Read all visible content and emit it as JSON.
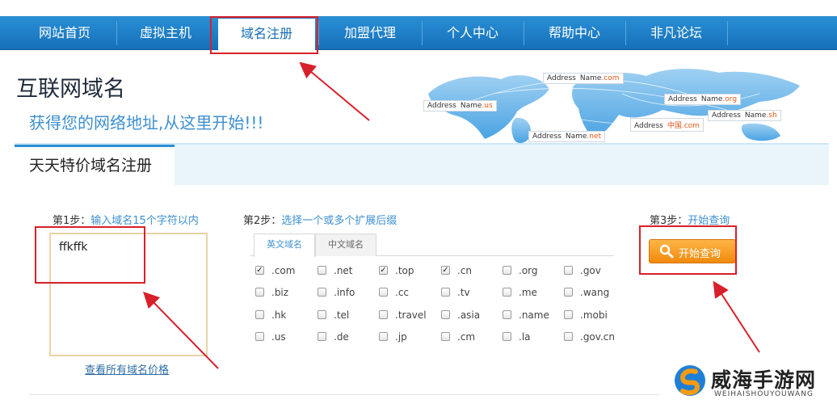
{
  "nav": {
    "items": [
      "网站首页",
      "虚拟主机",
      "域名注册",
      "加盟代理",
      "个人中心",
      "帮助中心",
      "非凡论坛"
    ],
    "active_index": 2
  },
  "header": {
    "title": "互联网域名",
    "subtitle": "获得您的网络地址,从这里开始!!!"
  },
  "map": {
    "tags": [
      {
        "addr": "Address",
        "name": "Name",
        "tld": ".com"
      },
      {
        "addr": "Address",
        "name": "Name",
        "tld": ".us"
      },
      {
        "addr": "Address",
        "name": "Name",
        "tld": ".org"
      },
      {
        "addr": "Address",
        "name": "Name",
        "tld": ".sh"
      },
      {
        "addr": "Address",
        "name": "中国",
        "tld": ".com"
      },
      {
        "addr": "Address",
        "name": "Name",
        "tld": ".net"
      }
    ]
  },
  "panel": {
    "tab_label": "天天特价域名注册"
  },
  "step1": {
    "prefix": "第1步：",
    "text": "输入域名15个字符以内",
    "input_value": "ffkffk",
    "price_link": "查看所有域名价格"
  },
  "step2": {
    "prefix": "第2步：",
    "text": "选择一个或多个扩展后缀",
    "tabs": [
      "英文域名",
      "中文域名"
    ],
    "active_tab": 0,
    "extensions": [
      [
        {
          "ext": ".com",
          "checked": true
        },
        {
          "ext": ".net",
          "checked": false
        },
        {
          "ext": ".top",
          "checked": true
        },
        {
          "ext": ".cn",
          "checked": true
        },
        {
          "ext": ".org",
          "checked": false
        },
        {
          "ext": ".gov",
          "checked": false
        }
      ],
      [
        {
          "ext": ".biz",
          "checked": false
        },
        {
          "ext": ".info",
          "checked": false
        },
        {
          "ext": ".cc",
          "checked": false
        },
        {
          "ext": ".tv",
          "checked": false
        },
        {
          "ext": ".me",
          "checked": false
        },
        {
          "ext": ".wang",
          "checked": false
        }
      ],
      [
        {
          "ext": ".hk",
          "checked": false
        },
        {
          "ext": ".tel",
          "checked": false
        },
        {
          "ext": ".travel",
          "checked": false
        },
        {
          "ext": ".asia",
          "checked": false
        },
        {
          "ext": ".name",
          "checked": false
        },
        {
          "ext": ".mobi",
          "checked": false
        }
      ],
      [
        {
          "ext": ".us",
          "checked": false
        },
        {
          "ext": ".de",
          "checked": false
        },
        {
          "ext": ".jp",
          "checked": false
        },
        {
          "ext": ".cm",
          "checked": false
        },
        {
          "ext": ".la",
          "checked": false
        },
        {
          "ext": ".gov.cn",
          "checked": false
        }
      ]
    ]
  },
  "step3": {
    "prefix": "第3步：",
    "text": "开始查询",
    "button_label": "开始查询"
  },
  "watermark": {
    "text": "威海手游网",
    "sub": "WEIHAISHOUYOUWANG"
  },
  "colors": {
    "nav_bg": "#1a7ec6",
    "accent": "#3d8fd0",
    "button": "#f5a020",
    "highlight_box": "#d8202a"
  }
}
